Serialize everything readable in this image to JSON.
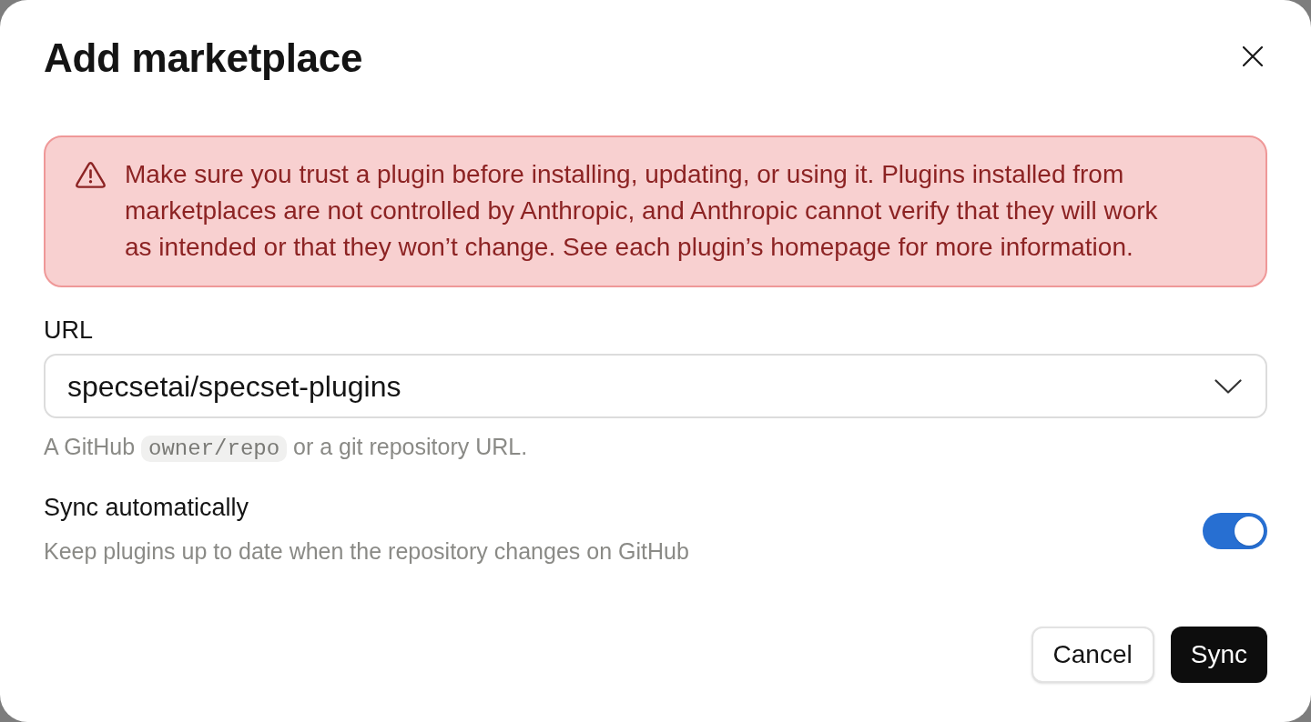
{
  "dialog": {
    "title": "Add marketplace"
  },
  "warning": {
    "text": "Make sure you trust a plugin before installing, updating, or using it. Plugins installed from marketplaces are not controlled by Anthropic, and Anthropic cannot verify that they will work as intended or that they won’t change. See each plugin’s homepage for more information."
  },
  "url_field": {
    "label": "URL",
    "value": "specsetai/specset-plugins",
    "hint": [
      {
        "kind": "text",
        "text": "A GitHub"
      },
      {
        "kind": "code",
        "text": "owner/repo"
      },
      {
        "kind": "text",
        "text": "or a git repository URL."
      }
    ]
  },
  "sync_setting": {
    "label": "Sync automatically",
    "description": "Keep plugins up to date when the repository changes on GitHub",
    "on": true
  },
  "buttons": [
    {
      "label": "Cancel",
      "kind": "secondary"
    },
    {
      "label": "Sync",
      "kind": "primary"
    }
  ]
}
